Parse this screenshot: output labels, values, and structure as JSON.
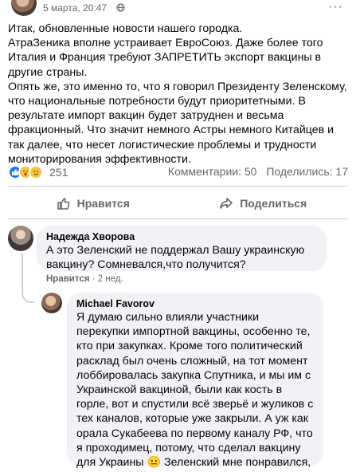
{
  "post": {
    "time": "5 марта, 20:47",
    "privacy_icon": "globe-icon",
    "more_icon": "more-dots-icon",
    "more_label": "···",
    "paragraphs": [
      "Итак, обновленные новости нашего городка.",
      "АтраЗеника вполне устраивает ЕвроСоюз. Даже более того Италия и Франция требуют ЗАПРЕТИТЬ экспорт вакцины в другие страны.",
      "Опять же, это именно то, что я говорил Президенту Зеленскому, что национальные потребности будут приоритетными. В результате импорт вакцин будет затруднен и весьма фракционный. Что значит немного Астры немного Китайцев и так далее, что несет логистические проблемы и трудности мониторирования эффективности."
    ]
  },
  "reactions": {
    "icons": [
      "like-icon",
      "wow-icon",
      "sad-icon"
    ],
    "count": "251",
    "comments": "Комментарии: 50",
    "shares": "Поделились: 17"
  },
  "actions": {
    "like_label": "Нравится",
    "share_label": "Поделиться"
  },
  "comments": [
    {
      "author": "Надежда Хворова",
      "text": "А это Зеленский не поддержал Вашу украинскую вакцину? Сомневался,что получится?",
      "like_label": "Нравится",
      "separator": "·",
      "time": "2 нед."
    }
  ],
  "reply": {
    "author": "Michael Favorov",
    "text": "Я думаю сильно влияли участники перекупки импортной вакцины, особенно те, кто при закупках. Кроме того политический расклад был очень сложный, на тот момент лоббировалась закупка Спутника, и мы им с Украинской вакциной, были как кость в горле, вот и спустили всё зверьё и жуликов с тех каналов, которые уже закрыли. А уж как орала Сукабеева по первому каналу РФ, что я проходимец, потому, что сделал вакцину для Украины 😐 Зеленский мне понравился, симпатичный"
  },
  "colors": {
    "secondary_text": "#65676b",
    "bubble_bg": "#f0f2f5",
    "like_blue": "#1877f2",
    "reaction_yellow": "#f7c444"
  }
}
